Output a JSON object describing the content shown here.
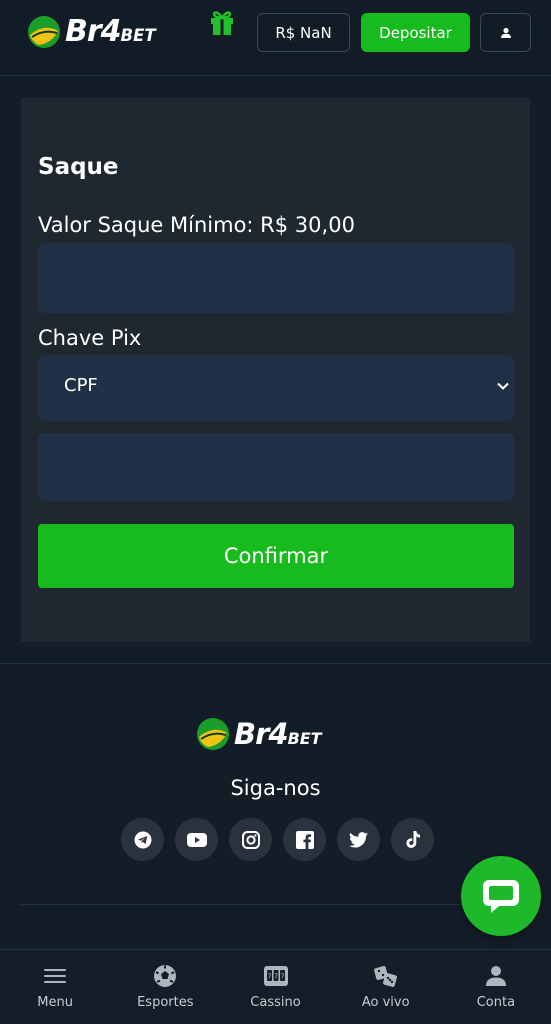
{
  "header": {
    "brand_main": "Br4",
    "brand_suffix": "BET",
    "balance_label": "R$ NaN",
    "deposit_label": "Depositar"
  },
  "withdraw": {
    "title": "Saque",
    "min_amount_label": "Valor Saque Mínimo: R$ 30,00",
    "amount_value": "",
    "pix_key_label": "Chave Pix",
    "pix_key_type_selected": "CPF",
    "pix_key_value": "",
    "confirm_label": "Confirmar"
  },
  "footer": {
    "brand_main": "Br4",
    "brand_suffix": "BET",
    "follow_title": "Siga-nos",
    "socials": [
      "telegram-icon",
      "youtube-icon",
      "instagram-icon",
      "facebook-icon",
      "twitter-icon",
      "tiktok-icon"
    ]
  },
  "bottom_nav": {
    "items": [
      {
        "label": "Menu",
        "icon": "menu-icon"
      },
      {
        "label": "Esportes",
        "icon": "soccer-ball-icon"
      },
      {
        "label": "Cassino",
        "icon": "slot-machine-icon"
      },
      {
        "label": "Ao vivo",
        "icon": "dice-icon"
      },
      {
        "label": "Conta",
        "icon": "user-icon"
      }
    ]
  },
  "colors": {
    "background": "#131d27",
    "card": "#1f2730",
    "input": "#213046",
    "accent_green": "#18bb1d"
  }
}
